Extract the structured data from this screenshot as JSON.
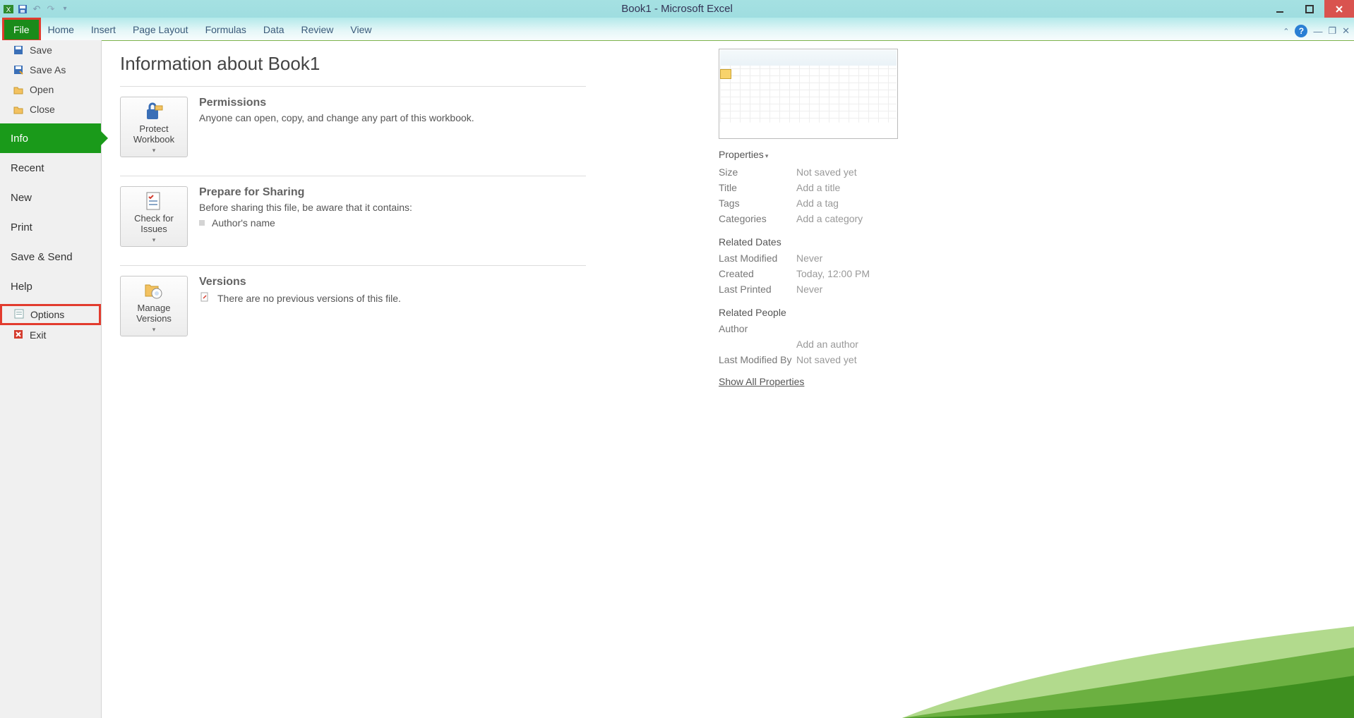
{
  "window": {
    "title": "Book1 - Microsoft Excel"
  },
  "ribbon": {
    "file": "File",
    "tabs": [
      "Home",
      "Insert",
      "Page Layout",
      "Formulas",
      "Data",
      "Review",
      "View"
    ]
  },
  "sidebar": {
    "top": [
      {
        "icon": "save-icon",
        "label": "Save"
      },
      {
        "icon": "save-as-icon",
        "label": "Save As"
      },
      {
        "icon": "open-icon",
        "label": "Open"
      },
      {
        "icon": "close-icon",
        "label": "Close"
      }
    ],
    "nav": [
      {
        "label": "Info",
        "selected": true
      },
      {
        "label": "Recent"
      },
      {
        "label": "New"
      },
      {
        "label": "Print"
      },
      {
        "label": "Save & Send"
      },
      {
        "label": "Help"
      }
    ],
    "bottom": [
      {
        "icon": "options-icon",
        "label": "Options",
        "highlight": true
      },
      {
        "icon": "exit-icon",
        "label": "Exit"
      }
    ]
  },
  "main": {
    "title": "Information about Book1",
    "permissions": {
      "button": "Protect Workbook",
      "heading": "Permissions",
      "text": "Anyone can open, copy, and change any part of this workbook."
    },
    "prepare": {
      "button": "Check for Issues",
      "heading": "Prepare for Sharing",
      "text": "Before sharing this file, be aware that it contains:",
      "bullet": "Author's name"
    },
    "versions": {
      "button": "Manage Versions",
      "heading": "Versions",
      "text": "There are no previous versions of this file."
    }
  },
  "props": {
    "heading": "Properties",
    "rows": [
      {
        "k": "Size",
        "v": "Not saved yet"
      },
      {
        "k": "Title",
        "v": "Add a title"
      },
      {
        "k": "Tags",
        "v": "Add a tag"
      },
      {
        "k": "Categories",
        "v": "Add a category"
      }
    ],
    "dates_heading": "Related Dates",
    "dates": [
      {
        "k": "Last Modified",
        "v": "Never"
      },
      {
        "k": "Created",
        "v": "Today, 12:00 PM"
      },
      {
        "k": "Last Printed",
        "v": "Never"
      }
    ],
    "people_heading": "Related People",
    "people": [
      {
        "k": "Author",
        "v": ""
      },
      {
        "k": "",
        "v": "Add an author"
      },
      {
        "k": "Last Modified By",
        "v": "Not saved yet"
      }
    ],
    "show_all": "Show All Properties"
  }
}
